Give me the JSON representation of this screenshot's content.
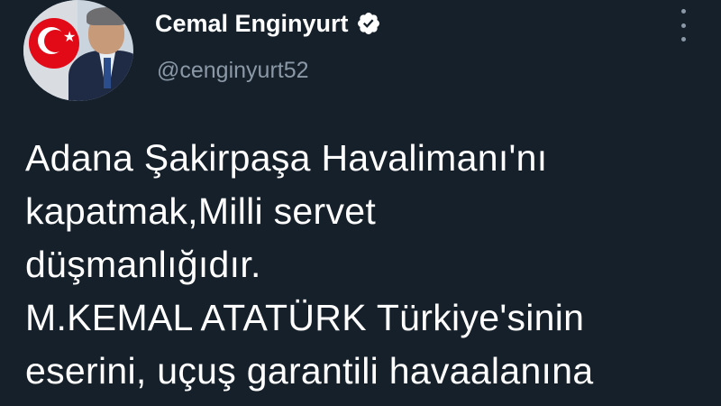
{
  "author": {
    "display_name": "Cemal Enginyurt",
    "handle": "@cenginyurt52",
    "verified": true
  },
  "icons": {
    "verified": "verified-badge-icon",
    "more": "more-options-icon"
  },
  "colors": {
    "background": "#15202b",
    "text": "#ffffff",
    "secondary_text": "#8b98a5"
  },
  "tweet": {
    "lines": [
      "Adana Şakirpaşa Havalimanı'nı",
      "kapatmak,Milli servet",
      "düşmanlığıdır.",
      "M.KEMAL ATATÜRK Türkiye'sinin",
      "eserini, uçuş garantili havaalanına"
    ]
  }
}
